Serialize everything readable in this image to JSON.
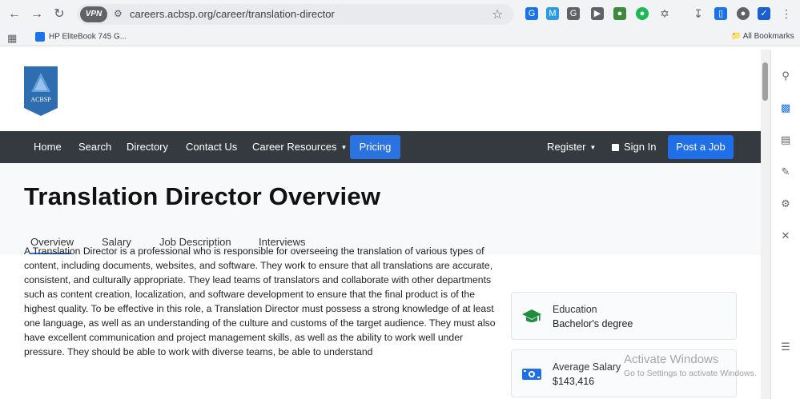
{
  "browser": {
    "url": "careers.acbsp.org/career/translation-director",
    "vpn_label": "VPN",
    "bookmark": "HP EliteBook 745 G...",
    "all_bookmarks": "All Bookmarks"
  },
  "logo": {
    "text": "ACBSP"
  },
  "nav": {
    "home": "Home",
    "search": "Search",
    "directory": "Directory",
    "contact": "Contact Us",
    "career_resources": "Career Resources",
    "pricing": "Pricing",
    "register": "Register",
    "sign_in": "Sign In",
    "post_job": "Post a Job"
  },
  "hero": {
    "title": "Translation Director Overview",
    "tabs": [
      "Overview",
      "Salary",
      "Job Description",
      "Interviews"
    ],
    "active_tab": "Overview"
  },
  "description": "A Translation Director is a professional who is responsible for overseeing the translation of various types of content, including documents, websites, and software. They work to ensure that all translations are accurate, consistent, and culturally appropriate. They lead teams of translators and collaborate with other departments such as content creation, localization, and software development to ensure that the final product is of the highest quality. To be effective in this role, a Translation Director must possess a strong knowledge of at least one language, as well as an understanding of the culture and customs of the target audience. They must also have excellent communication and project management skills, as well as the ability to work well under pressure. They should be able to work with diverse teams, be able to understand",
  "cards": {
    "education": {
      "label": "Education",
      "value": "Bachelor's degree"
    },
    "salary": {
      "label": "Average Salary",
      "value": "$143,416"
    }
  },
  "watermark": {
    "line1": "Activate Windows",
    "line2": "Go to Settings to activate Windows."
  },
  "colors": {
    "navbar": "#343a40",
    "accent": "#2b73e0",
    "logo": "#2f6db1",
    "icon_green": "#1e8e3e",
    "icon_blue": "#1f6fe8"
  }
}
